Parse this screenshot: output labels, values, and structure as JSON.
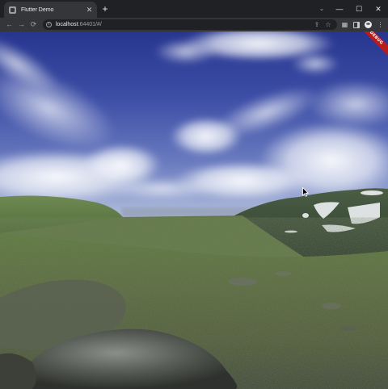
{
  "tab": {
    "title": "Flutter Demo",
    "close_glyph": "✕"
  },
  "new_tab_glyph": "+",
  "window_controls": {
    "chevron": "⌄",
    "minimize": "—",
    "maximize": "☐",
    "close": "✕"
  },
  "nav": {
    "back": "←",
    "forward": "→",
    "reload": "⟳"
  },
  "omnibox": {
    "url_host": "localhost",
    "url_rest": ":64401/#/"
  },
  "toolbar_icons": [
    "share-icon",
    "star-icon",
    "extensions-icon",
    "side-panel-icon",
    "profile-avatar",
    "menu-icon"
  ],
  "debug_banner": {
    "label": "DEBUG",
    "color": "#b71c1c"
  },
  "scene": {
    "description_icon": "panorama-mountain-landscape",
    "sky_top": "#2f3f9a",
    "sky_mid": "#5566b8",
    "horizon": "#aab8d6",
    "ground": "#58683a",
    "rock": "#4a4e46"
  }
}
